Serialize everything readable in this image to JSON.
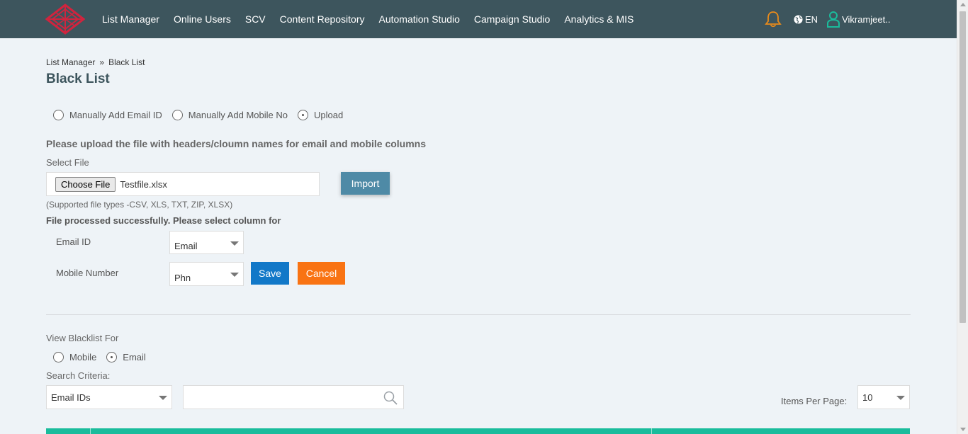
{
  "nav": {
    "items": [
      "List Manager",
      "Online Users",
      "SCV",
      "Content Repository",
      "Automation Studio",
      "Campaign Studio",
      "Analytics & MIS"
    ],
    "language": "EN",
    "user": "Vikramjeet.."
  },
  "breadcrumb": {
    "parent": "List Manager",
    "separator": "»",
    "current": "Black List"
  },
  "page": {
    "title": "Black List"
  },
  "add_mode": {
    "options": [
      "Manually Add Email ID",
      "Manually Add Mobile No",
      "Upload"
    ],
    "selected": "Upload"
  },
  "upload": {
    "heading": "Please upload the file with headers/cloumn names for email and mobile columns",
    "select_file_label": "Select File",
    "choose_file_label": "Choose File",
    "file_name": "Testfile.xlsx",
    "import_label": "Import",
    "supported_types": "(Supported file types -CSV, XLS, TXT, ZIP, XLSX)",
    "processed_message": "File processed successfully. Please select column for"
  },
  "mapping": {
    "email_label": "Email ID",
    "email_value": "Email",
    "mobile_label": "Mobile Number",
    "mobile_value": "Phn",
    "save_label": "Save",
    "cancel_label": "Cancel"
  },
  "view": {
    "label": "View Blacklist For",
    "options": [
      "Mobile",
      "Email"
    ],
    "selected": "Email",
    "search_criteria_label": "Search Criteria:",
    "criteria_value": "Email IDs",
    "search_value": "",
    "items_per_page_label": "Items Per Page:",
    "items_per_page_value": "10"
  },
  "colors": {
    "topbar": "#3d555d",
    "bell": "#e98b1a",
    "user_icon": "#1abc9c",
    "logo": "#d0243e",
    "import": "#4e8aa6",
    "save": "#1278c8",
    "cancel": "#f97313",
    "table_header": "#1abc9c"
  }
}
